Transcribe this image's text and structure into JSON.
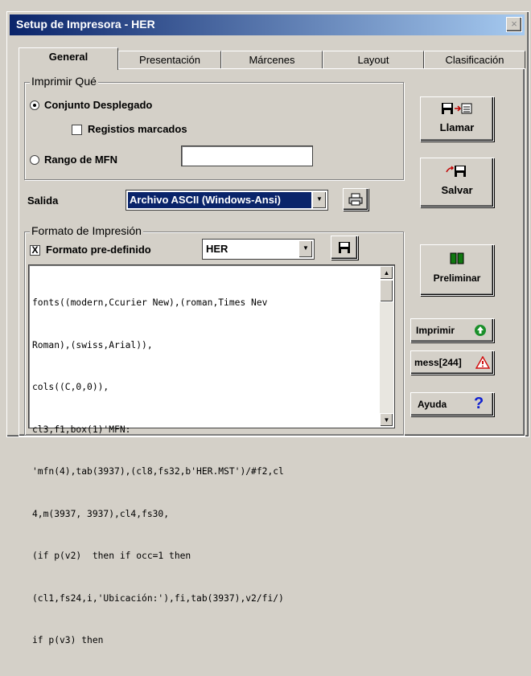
{
  "window": {
    "title": "Setup de Impresora - HER",
    "close_glyph": "×"
  },
  "tabs": [
    {
      "label": "General",
      "active": true
    },
    {
      "label": "Presentación",
      "active": false
    },
    {
      "label": "Márcenes",
      "active": false
    },
    {
      "label": "Layout",
      "active": false
    },
    {
      "label": "Clasificación",
      "active": false
    }
  ],
  "imprimir_que": {
    "legend": "Imprimir Qué",
    "conjunto_label": "Conjunto Desplegado",
    "conjunto_selected": true,
    "registros_label": "Registios marcados",
    "registros_checked": false,
    "rango_label": "Rango de MFN",
    "rango_selected": false,
    "rango_value": ""
  },
  "salida": {
    "label": "Salida",
    "value": "Archivo ASCII (Windows-Ansi)"
  },
  "formato": {
    "legend": "Formato de Impresión",
    "predefinido_label": "Formato pre-definido",
    "predefinido_checked": true,
    "predefinido_mark": "X",
    "format_name": "HER",
    "code_lines": [
      "fonts((modern,Ccurier New),(roman,Times Nev",
      "Roman),(swiss,Arial)),",
      "cols((C,0,0)),",
      "cl3,f1,box(1)'MFN:",
      "'mfn(4),tab(3937),(cl8,fs32,b'HER.MST')/#f2,cl",
      "4,m(3937, 3937),cl4,fs30,",
      "(if p(v2)  then if occ=1 then",
      "(cl1,fs24,i,'Ubicación:'),fi,tab(3937),v2/fi/)",
      "if p(v3) then"
    ]
  },
  "buttons": {
    "llamar": "Llamar",
    "salvar": "Salvar",
    "preliminar": "Preliminar",
    "imprimir": "Imprimir",
    "mess": "mess[244]",
    "ayuda": "Ayuda",
    "ayuda_glyph": "?"
  },
  "colors": {
    "title_start": "#0a246a",
    "title_end": "#a6caf0",
    "face": "#d4d0c8",
    "print_green": "#1a8f2a",
    "warn_red": "#d01010",
    "help_blue": "#1020d0"
  }
}
